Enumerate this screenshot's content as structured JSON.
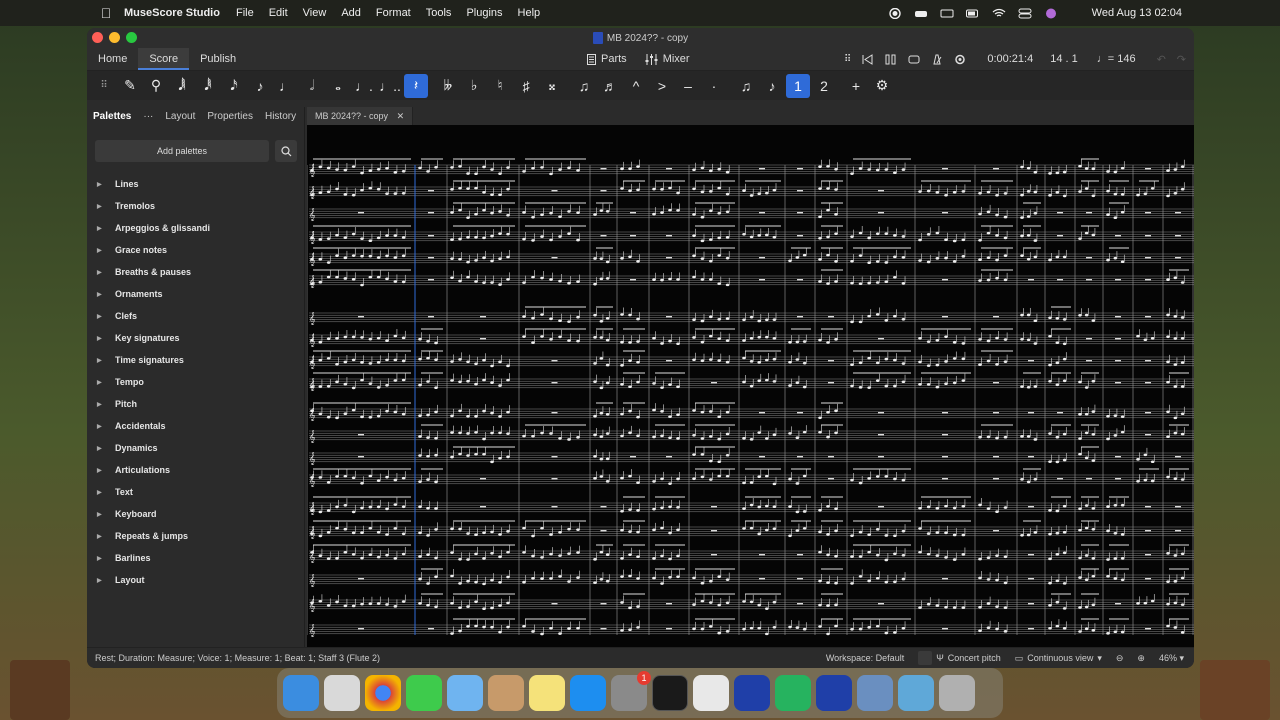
{
  "menubar": {
    "app_name": "MuseScore Studio",
    "items": [
      "File",
      "Edit",
      "View",
      "Add",
      "Format",
      "Tools",
      "Plugins",
      "Help"
    ],
    "clock": "Wed Aug 13  02:04"
  },
  "window": {
    "title": "MB 2024?? - copy"
  },
  "topbar": {
    "tabs": [
      "Home",
      "Score",
      "Publish"
    ],
    "active_tab": "Score",
    "parts_label": "Parts",
    "mixer_label": "Mixer",
    "time": "0:00:21:4",
    "measure": "14 . 1",
    "tempo": "= 146"
  },
  "panel": {
    "tabs": [
      "Palettes",
      "Layout",
      "Properties",
      "History"
    ],
    "add_palettes": "Add palettes",
    "palettes": [
      "Lines",
      "Tremolos",
      "Arpeggios & glissandi",
      "Grace notes",
      "Breaths & pauses",
      "Ornaments",
      "Clefs",
      "Key signatures",
      "Time signatures",
      "Tempo",
      "Pitch",
      "Accidentals",
      "Dynamics",
      "Articulations",
      "Text",
      "Keyboard",
      "Repeats & jumps",
      "Barlines",
      "Layout"
    ]
  },
  "document_tab": {
    "label": "MB 2024?? - copy"
  },
  "statusbar": {
    "selection": "Rest; Duration: Measure; Voice: 1; Measure: 1; Beat: 1; Staff 3 (Flute 2)",
    "workspace": "Workspace: Default",
    "concert_pitch": "Concert pitch",
    "view_mode": "Continuous view",
    "zoom": "46%"
  },
  "dock": {
    "badge_count": "1"
  },
  "colors": {
    "accent": "#2f6bd8",
    "window_bg": "#2b2b2b",
    "score_bg": "#050505"
  }
}
